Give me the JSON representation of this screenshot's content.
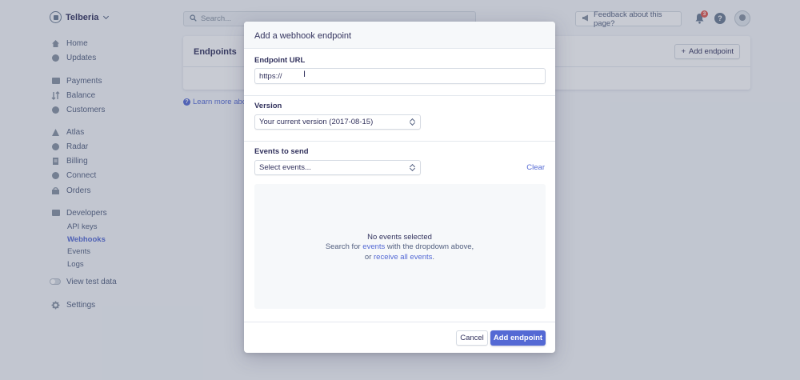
{
  "sidebar": {
    "account": "Telberia",
    "groups": [
      [
        {
          "label": "Home",
          "icon": "home-icon"
        },
        {
          "label": "Updates",
          "icon": "updates-icon"
        }
      ],
      [
        {
          "label": "Payments",
          "icon": "payments-icon"
        },
        {
          "label": "Balance",
          "icon": "balance-icon"
        },
        {
          "label": "Customers",
          "icon": "customers-icon"
        }
      ],
      [
        {
          "label": "Atlas",
          "icon": "atlas-icon"
        },
        {
          "label": "Radar",
          "icon": "radar-icon"
        },
        {
          "label": "Billing",
          "icon": "billing-icon"
        },
        {
          "label": "Connect",
          "icon": "connect-icon"
        },
        {
          "label": "Orders",
          "icon": "orders-icon"
        }
      ]
    ],
    "developers": {
      "label": "Developers",
      "items": [
        "API keys",
        "Webhooks",
        "Events",
        "Logs"
      ],
      "active": "Webhooks"
    },
    "view_test_data": "View test data",
    "settings": "Settings"
  },
  "header": {
    "search_placeholder": "Search...",
    "feedback": "Feedback about this page?",
    "notification_count": "3"
  },
  "page": {
    "title": "Endpoints",
    "add_button": "Add endpoint",
    "learn_more": "Learn more abo"
  },
  "modal": {
    "title": "Add a webhook endpoint",
    "url_label": "Endpoint URL",
    "url_value": "https://",
    "version_label": "Version",
    "version_value": "Your current version (2017-08-15)",
    "events_label": "Events to send",
    "events_placeholder": "Select events...",
    "clear": "Clear",
    "empty_title": "No events selected",
    "empty_line1_pre": "Search for ",
    "empty_line1_link": "events",
    "empty_line1_post": " with the dropdown above,",
    "empty_line2_pre": "or ",
    "empty_line2_link": "receive all events",
    "empty_line2_post": ".",
    "cancel": "Cancel",
    "submit": "Add endpoint"
  },
  "colors": {
    "accent": "#5469d4",
    "text": "#32325d",
    "badge": "#e25950"
  }
}
